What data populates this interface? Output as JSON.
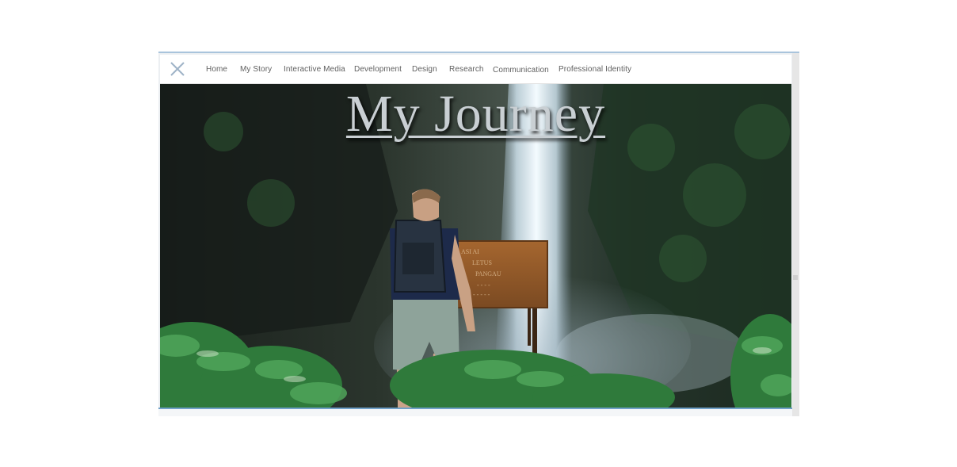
{
  "nav": {
    "close_icon": "close-icon",
    "items": [
      {
        "label": "Home"
      },
      {
        "label": "My Story"
      },
      {
        "label": "Interactive Media"
      },
      {
        "label": "Development"
      },
      {
        "label": "Design"
      },
      {
        "label": "Research"
      },
      {
        "label": "Communication"
      },
      {
        "label": "Professional Identity"
      }
    ]
  },
  "hero": {
    "title": "My Journey",
    "image": "hiker-at-waterfall-image",
    "sign_text": [
      "ASI AI",
      "LETUS",
      "PANGAU",
      "...",
      "..."
    ]
  },
  "colors": {
    "nav_text": "#5f5f5f",
    "close_icon": "#9fb3c7",
    "title": "#c9cfd3",
    "frame_border": "#6fa0c8"
  }
}
